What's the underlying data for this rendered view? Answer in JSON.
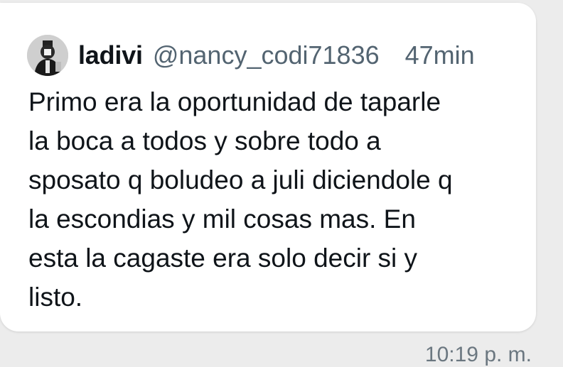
{
  "message": {
    "author_name": "ladivi",
    "author_handle": "@nancy_codi71836",
    "relative_time": "47min",
    "lines": [
      "Primo era la oportunidad de taparle",
      "la boca a todos y sobre todo a",
      "sposato q boludeo a juli diciendole q",
      "la escondias y mil cosas mas. En",
      "esta la cagaste era solo decir si y",
      "listo."
    ],
    "avatar_icon": "user-avatar-icon"
  },
  "footer": {
    "timestamp": "10:19 p. m."
  }
}
